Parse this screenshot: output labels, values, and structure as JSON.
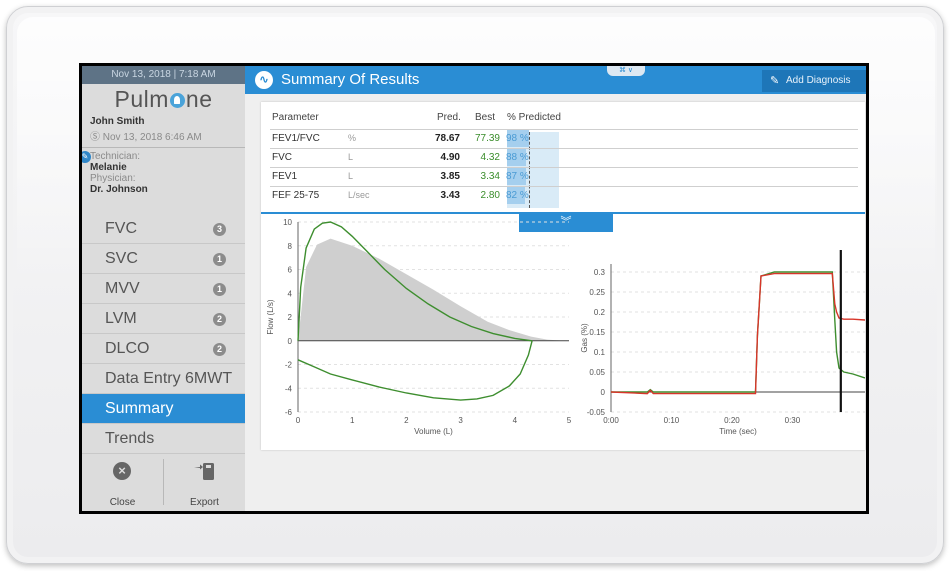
{
  "sidebar": {
    "datetime": "Nov 13, 2018 | 7:18 AM",
    "logo": {
      "pre": "Pulm",
      "post": "ne"
    },
    "patient_name": "John  Smith",
    "test_date": "Ⓢ Nov 13, 2018 6:46 AM",
    "technician_label": "Technician:",
    "technician": "Melanie",
    "physician_label": "Physician:",
    "physician": "Dr. Johnson",
    "menu": [
      {
        "label": "FVC",
        "badge": "3"
      },
      {
        "label": "SVC",
        "badge": "1"
      },
      {
        "label": "MVV",
        "badge": "1"
      },
      {
        "label": "LVM",
        "badge": "2"
      },
      {
        "label": "DLCO",
        "badge": "2"
      },
      {
        "label": "Data Entry 6MWT",
        "badge": ""
      },
      {
        "label": "Summary",
        "badge": ""
      },
      {
        "label": "Trends",
        "badge": ""
      }
    ],
    "active_item": "Summary",
    "close_label": "Close",
    "export_label": "Export"
  },
  "header": {
    "title": "Summary Of Results",
    "add_diagnosis": "Add Diagnosis",
    "tab_glyph": "⌘ ∨"
  },
  "table": {
    "headers": {
      "parameter": "Parameter",
      "pred": "Pred.",
      "best": "Best",
      "pct": "% Predicted"
    },
    "rows": [
      {
        "param": "FEV1/FVC",
        "unit": "%",
        "pred": "78.67",
        "best": "77.39",
        "pct": "98 %",
        "pct_value": 98
      },
      {
        "param": "FVC",
        "unit": "L",
        "pred": "4.90",
        "best": "4.32",
        "pct": "88 %",
        "pct_value": 88
      },
      {
        "param": "FEV1",
        "unit": "L",
        "pred": "3.85",
        "best": "3.34",
        "pct": "87 %",
        "pct_value": 87
      },
      {
        "param": "FEF 25-75",
        "unit": "L/sec",
        "pred": "3.43",
        "best": "2.80",
        "pct": "82 %",
        "pct_value": 82
      }
    ]
  },
  "colors": {
    "accent": "#2a8dd4",
    "best": "#3a8d2b",
    "curve_green": "#3e8e2f",
    "curve_red": "#d8352a",
    "predicted_fill": "#cfcfcf"
  },
  "chart_data": [
    {
      "type": "line",
      "chart": "flow-volume",
      "xlabel": "Volume (L)",
      "ylabel": "Flow (L/s)",
      "xlim": [
        0,
        5
      ],
      "ylim": [
        -6,
        10
      ],
      "xticks": [
        "0",
        "1",
        "2",
        "3",
        "4",
        "5"
      ],
      "yticks": [
        "10",
        "8",
        "6",
        "4",
        "2",
        "0",
        "-2",
        "-4",
        "-6"
      ],
      "predicted_area": {
        "x": [
          0,
          0.15,
          0.35,
          0.6,
          1.0,
          1.5,
          2.0,
          2.5,
          3.0,
          3.5,
          3.9,
          4.3,
          4.6,
          4.9
        ],
        "y": [
          0,
          6.2,
          8.1,
          8.6,
          8.0,
          6.9,
          5.6,
          4.3,
          2.9,
          1.6,
          0.9,
          0.35,
          0.1,
          0
        ]
      },
      "expiratory": {
        "x": [
          0,
          0.05,
          0.15,
          0.3,
          0.45,
          0.6,
          0.8,
          1.0,
          1.3,
          1.6,
          2.0,
          2.4,
          2.8,
          3.2,
          3.6,
          4.0,
          4.32
        ],
        "y": [
          0,
          4.5,
          7.8,
          9.4,
          9.9,
          10.0,
          9.6,
          8.8,
          7.4,
          6.0,
          4.4,
          3.1,
          2.0,
          1.2,
          0.6,
          0.2,
          0
        ]
      },
      "inspiratory": {
        "x": [
          0,
          0.3,
          0.6,
          1.0,
          1.5,
          2.0,
          2.5,
          3.0,
          3.3,
          3.6,
          3.9,
          4.1,
          4.25,
          4.32
        ],
        "y": [
          -1.6,
          -2.2,
          -2.8,
          -3.3,
          -3.9,
          -4.4,
          -4.8,
          -5.0,
          -4.9,
          -4.6,
          -3.8,
          -2.8,
          -1.2,
          0
        ]
      }
    },
    {
      "type": "line",
      "chart": "gas-concentration",
      "xlabel": "Time (sec)",
      "ylabel": "Gas (%)",
      "xlim": [
        0,
        42
      ],
      "ylim": [
        -0.05,
        0.32
      ],
      "xticks": [
        "0:00",
        "0:10",
        "0:20",
        "0:30"
      ],
      "yticks": [
        "0.3",
        "0.25",
        "0.2",
        "0.15",
        "0.1",
        "0.05",
        "0",
        "-0.05"
      ],
      "marker_time": 38.0,
      "series": [
        {
          "color": "#3e8e2f",
          "x": [
            0,
            6,
            6.5,
            7,
            16,
            23.9,
            24.2,
            24.8,
            27,
            30,
            33,
            36.6,
            37.0,
            37.3,
            37.7,
            38.5,
            40,
            42
          ],
          "y": [
            0,
            0.0,
            0.006,
            0.0,
            0.0,
            0.0,
            0.14,
            0.29,
            0.3,
            0.3,
            0.3,
            0.3,
            0.18,
            0.1,
            0.06,
            0.05,
            0.045,
            0.035
          ]
        },
        {
          "color": "#d8352a",
          "x": [
            0,
            6,
            6.5,
            7,
            16,
            23.9,
            24.2,
            24.8,
            27,
            30,
            33,
            36.6,
            37.0,
            37.3,
            37.7,
            38.5,
            40,
            42
          ],
          "y": [
            0,
            -0.004,
            0.004,
            -0.004,
            -0.004,
            -0.004,
            0.14,
            0.29,
            0.296,
            0.296,
            0.296,
            0.296,
            0.22,
            0.2,
            0.185,
            0.182,
            0.182,
            0.18
          ]
        }
      ]
    }
  ]
}
